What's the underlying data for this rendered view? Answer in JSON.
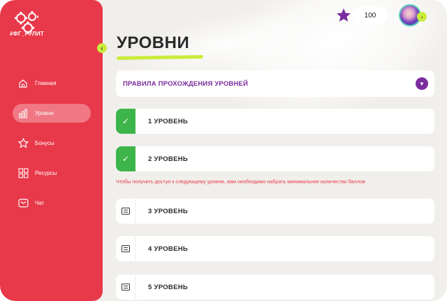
{
  "brand": {
    "logo_text": "#ФГ_РУЛИТ"
  },
  "sidebar": {
    "items": [
      {
        "label": "Главная",
        "icon": "home-icon",
        "active": false
      },
      {
        "label": "Уровни",
        "icon": "bar-chart-icon",
        "active": true
      },
      {
        "label": "Бонусы",
        "icon": "star-icon",
        "active": false
      },
      {
        "label": "Ресурсы",
        "icon": "grid-icon",
        "active": false
      },
      {
        "label": "Чат",
        "icon": "chat-icon",
        "active": false
      }
    ]
  },
  "header": {
    "points": "100"
  },
  "page": {
    "title": "УРОВНИ"
  },
  "rules": {
    "label": "ПРАВИЛА ПРОХОЖДЕНИЯ УРОВНЕЙ"
  },
  "levels": [
    {
      "label": "1 УРОВЕНЬ",
      "status": "completed",
      "icon": "check-icon"
    },
    {
      "label": "2 УРОВЕНЬ",
      "status": "completed",
      "icon": "check-icon"
    },
    {
      "label": "3 УРОВЕНЬ",
      "status": "locked",
      "icon": "document-icon"
    },
    {
      "label": "4 УРОВЕНЬ",
      "status": "locked",
      "icon": "document-icon"
    },
    {
      "label": "5 УРОВЕНЬ",
      "status": "locked",
      "icon": "document-icon"
    }
  ],
  "notice": "Чтобы получить доступ к следующему уровню, вам необходимо набрать минимальное количество баллов",
  "colors": {
    "sidebar_red": "#e8394a",
    "accent_lime": "#c9ec3c",
    "accent_purple": "#7b2d9d",
    "success_green": "#3db54a"
  }
}
